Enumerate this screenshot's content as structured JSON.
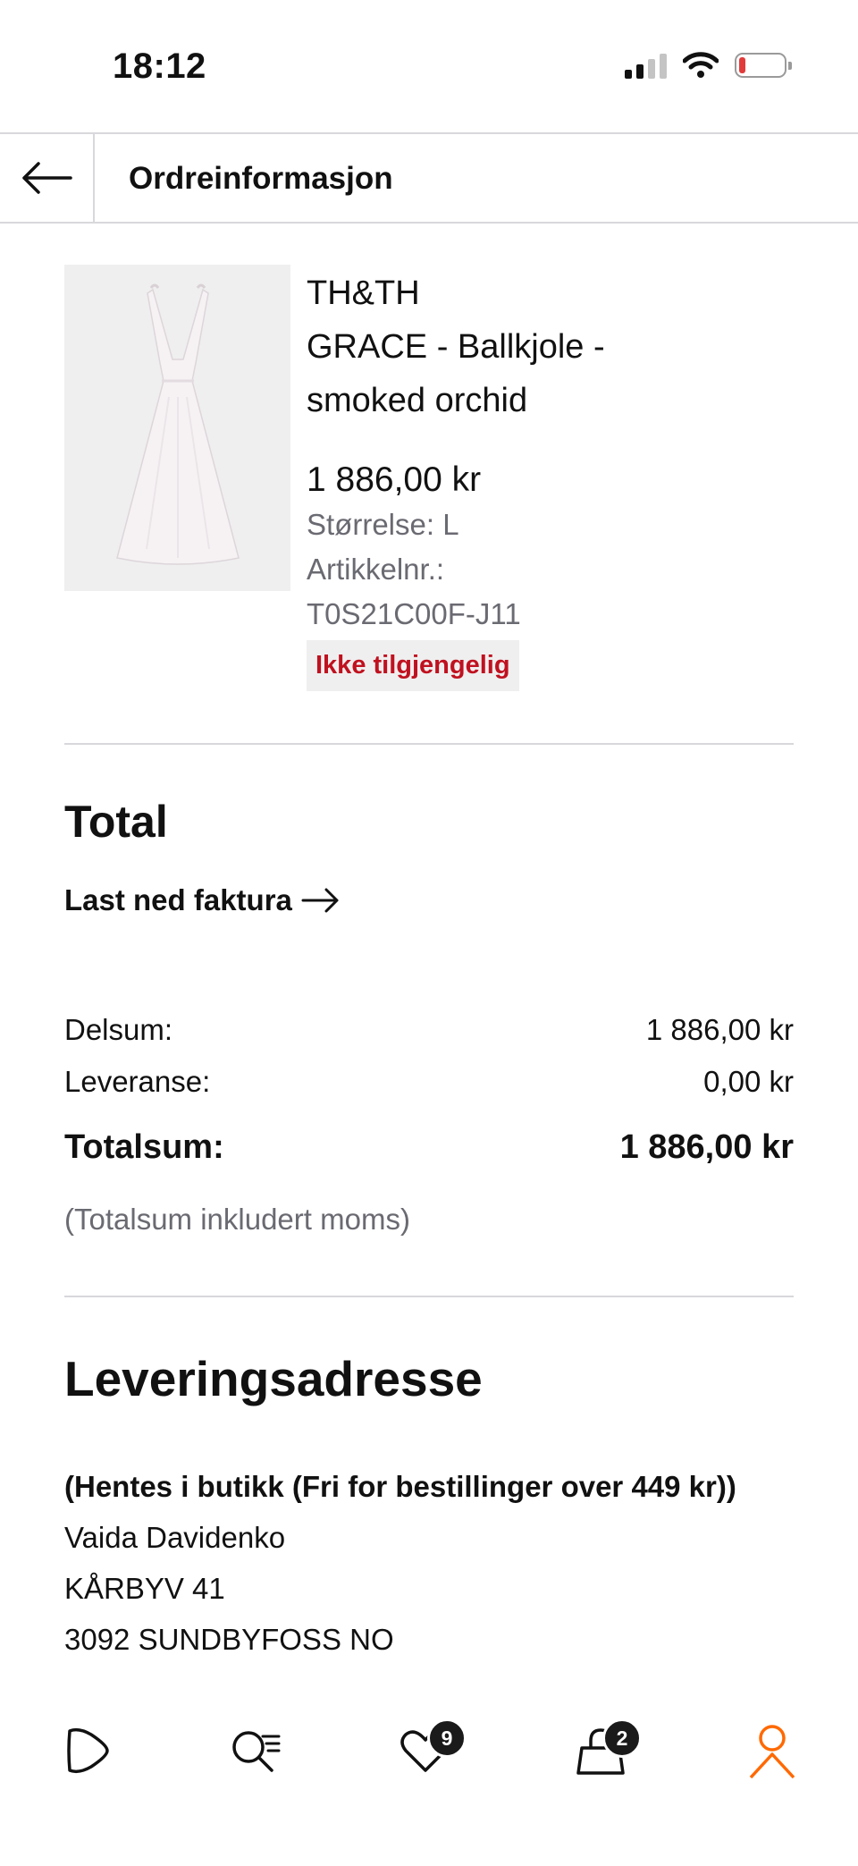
{
  "status_bar": {
    "time": "18:12",
    "icons": [
      "signal-icon",
      "wifi-icon",
      "battery-icon"
    ],
    "battery_level": 0.15
  },
  "header": {
    "title": "Ordreinformasjon"
  },
  "product": {
    "brand": "TH&TH",
    "name": "GRACE - Ballkjole - smoked orchid",
    "price": "1 886,00 kr",
    "size": "Størrelse: L",
    "article_label": "Artikkelnr.:",
    "article_number": "T0S21C00F-J11",
    "availability": "Ikke tilgjengelig",
    "availability_color": "#c0111f"
  },
  "total": {
    "title": "Total",
    "invoice_link": "Last ned faktura",
    "subtotal_label": "Delsum:",
    "subtotal_value": "1 886,00 kr",
    "delivery_label": "Leveranse:",
    "delivery_value": "0,00 kr",
    "total_label": "Totalsum:",
    "total_value": "1 886,00 kr",
    "vat_note": "(Totalsum inkludert moms)"
  },
  "delivery_address": {
    "title": "Leveringsadresse",
    "method": "(Hentes i butikk (Fri for bestillinger over 449 kr))",
    "name": "Vaida Davidenko",
    "street": "KÅRBYV 41",
    "city": "3092 SUNDBYFOSS NO"
  },
  "bottom_nav": {
    "items": [
      "home-icon",
      "search-icon",
      "wishlist-icon",
      "bag-icon",
      "account-icon"
    ],
    "wishlist_count": "9",
    "bag_count": "2",
    "active_color": "#ff6900"
  }
}
